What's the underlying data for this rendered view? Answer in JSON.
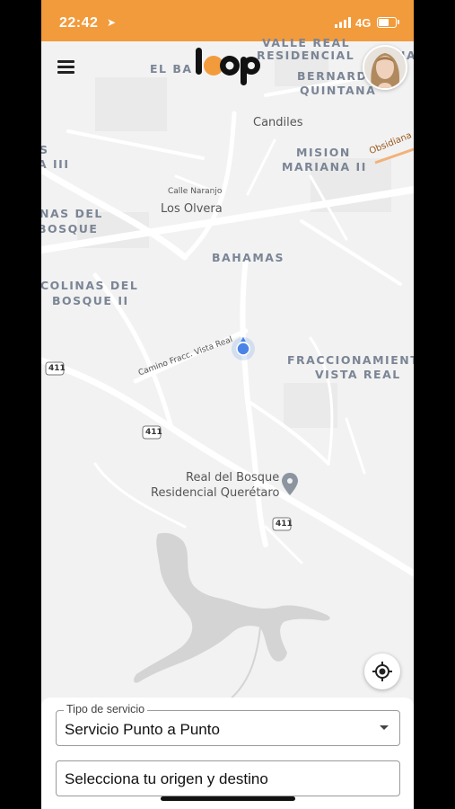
{
  "status_bar": {
    "time": "22:42",
    "network": "4G"
  },
  "map": {
    "labels": {
      "el_ba": "EL BA",
      "valle_real_1": "VALLE REAL",
      "valle_real_2": "RESIDENCIAL",
      "na": "NA",
      "bernardo_1": "BERNARD",
      "bernardo_2": "QUINTANA",
      "candiles": "Candiles",
      "mision_1": "MISION",
      "mision_2": "MARIANA II",
      "obsidiana": "Obsidiana",
      "s_a_iii_1": "S",
      "s_a_iii_2": "A III",
      "calle_naranjo": "Calle Naranjo",
      "los_olvera": "Los Olvera",
      "colinas_1": "NAS DEL",
      "colinas_2": "BOSQUE",
      "bahamas": "BAHAMAS",
      "colinas_ii_1": "COLINAS DEL",
      "colinas_ii_2": "BOSQUE II",
      "camino": "Camino Fracc. Vista Real",
      "vista_real_1": "FRACCIONAMIENTO",
      "vista_real_2": "VISTA REAL",
      "hw_411_a": "411",
      "hw_411_b": "411",
      "hw_411_c": "411",
      "real_bosque_1": "Real del Bosque",
      "real_bosque_2": "Residencial Querétaro"
    }
  },
  "header": {
    "logo_text": "loop",
    "avatar_icon": "user-avatar"
  },
  "panel": {
    "service_label": "Tipo de servicio",
    "service_value": "Servicio Punto a Punto",
    "route_value": "Selecciona tu origen y destino"
  },
  "colors": {
    "accent": "#f29b3c",
    "map_bg": "#f2f2f2",
    "water": "#d3d3d3",
    "location": "#4a84e6"
  }
}
